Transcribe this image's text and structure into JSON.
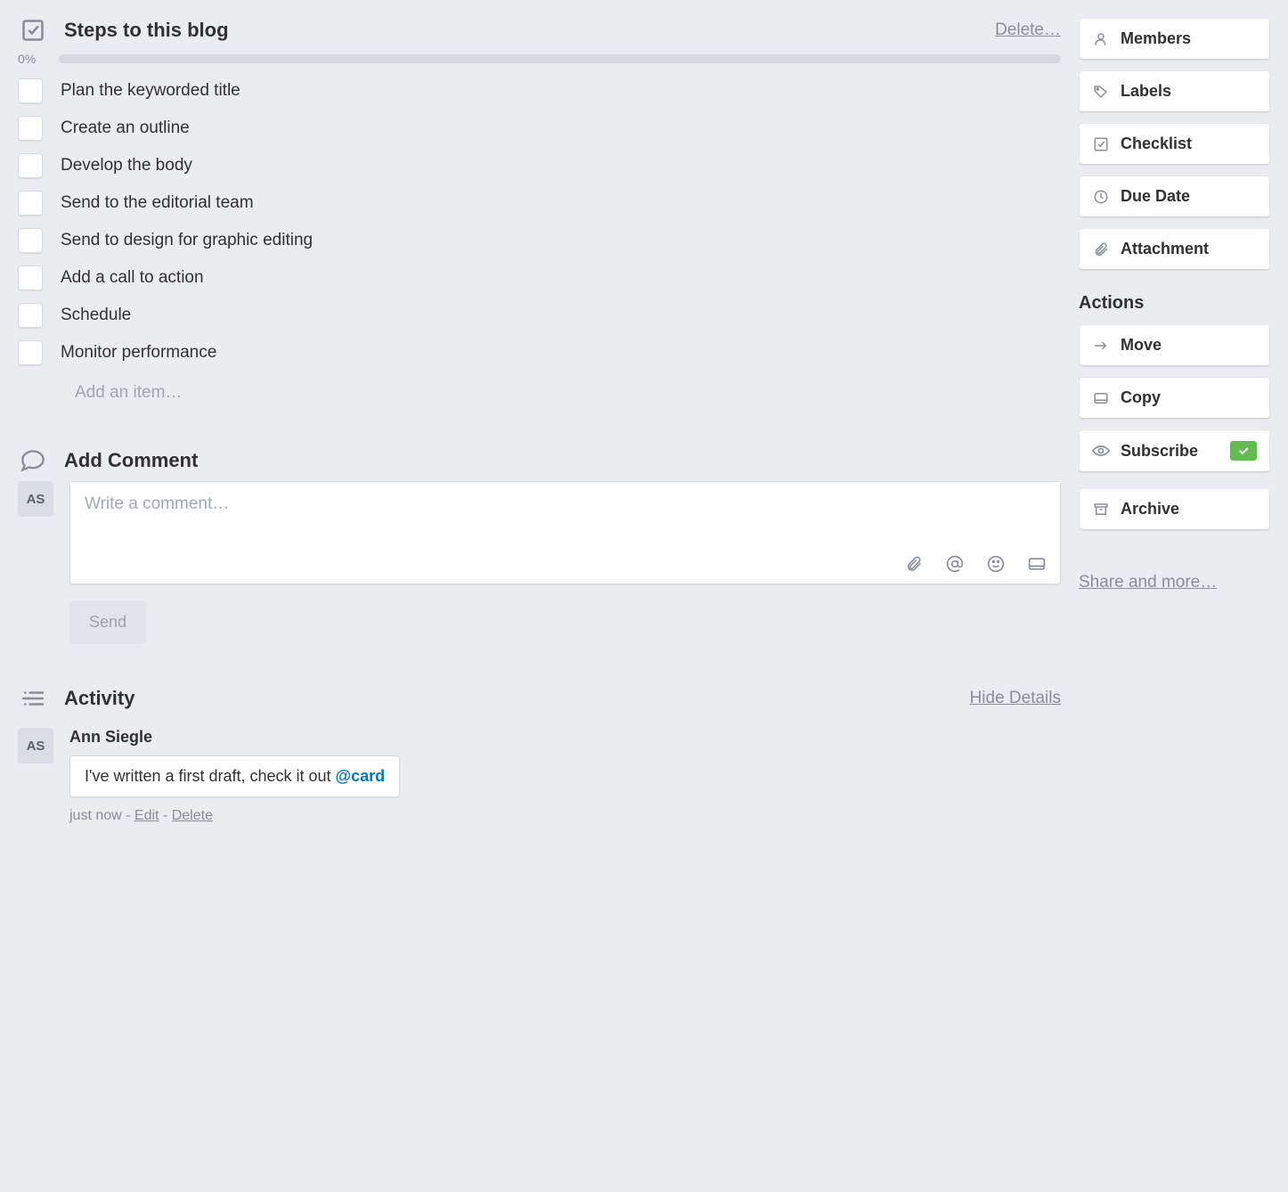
{
  "checklist": {
    "title": "Steps to this blog",
    "delete_label": "Delete…",
    "progress_pct": "0%",
    "items": [
      "Plan the keyworded title",
      "Create an outline",
      "Develop the body",
      "Send to the editorial team",
      "Send to design for graphic editing",
      "Add a call to action",
      "Schedule",
      "Monitor performance"
    ],
    "add_item_placeholder": "Add an item…"
  },
  "comment": {
    "title": "Add Comment",
    "avatar_initials": "AS",
    "placeholder": "Write a comment…",
    "send_label": "Send"
  },
  "activity": {
    "title": "Activity",
    "hide_label": "Hide Details",
    "entries": [
      {
        "avatar": "AS",
        "author": "Ann Siegle",
        "text": "I've written a first draft, check it out ",
        "mention": "@card",
        "time": "just now",
        "edit_label": "Edit",
        "delete_label": "Delete"
      }
    ]
  },
  "sidebar": {
    "add": [
      {
        "label": "Members"
      },
      {
        "label": "Labels"
      },
      {
        "label": "Checklist"
      },
      {
        "label": "Due Date"
      },
      {
        "label": "Attachment"
      }
    ],
    "actions_heading": "Actions",
    "actions": [
      {
        "label": "Move"
      },
      {
        "label": "Copy"
      },
      {
        "label": "Subscribe",
        "checked": true
      },
      {
        "label": "Archive"
      }
    ],
    "share_label": "Share and more…"
  }
}
